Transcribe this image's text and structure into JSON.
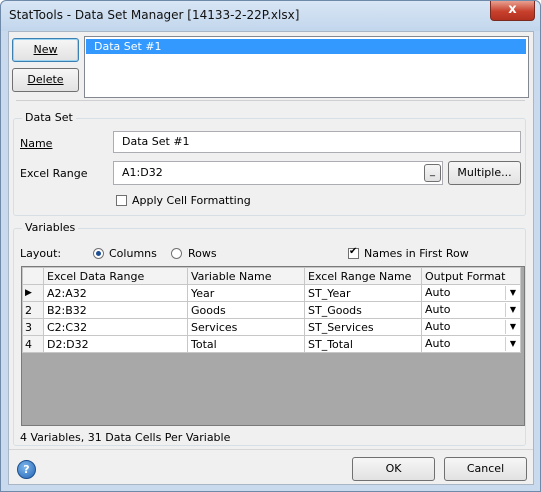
{
  "window": {
    "title": "StatTools - Data Set Manager [14133-2-22P.xlsx]",
    "close_glyph": "x"
  },
  "datasets": {
    "new_label": "New",
    "delete_label": "Delete",
    "items": [
      "Data Set #1"
    ]
  },
  "dataset_group": {
    "title": "Data Set",
    "name_label": "Name",
    "name_value": "Data Set #1",
    "range_label": "Excel Range",
    "range_value": "A1:D32",
    "range_picker_glyph": "_",
    "multiple_label": "Multiple...",
    "apply_format_label": "Apply Cell Formatting",
    "apply_format_checked": false
  },
  "variables_group": {
    "title": "Variables",
    "layout_label": "Layout:",
    "columns_label": "Columns",
    "rows_label": "Rows",
    "layout_selected": "Columns",
    "names_first_row_label": "Names in First Row",
    "names_first_row_checked": true,
    "columns": [
      "Excel Data Range",
      "Variable Name",
      "Excel Range Name",
      "Output Format"
    ],
    "rows": [
      {
        "header": "▶",
        "range": "A2:A32",
        "name": "Year",
        "range_name": "ST_Year",
        "format": "Auto"
      },
      {
        "header": "2",
        "range": "B2:B32",
        "name": "Goods",
        "range_name": "ST_Goods",
        "format": "Auto"
      },
      {
        "header": "3",
        "range": "C2:C32",
        "name": "Services",
        "range_name": "ST_Services",
        "format": "Auto"
      },
      {
        "header": "4",
        "range": "D2:D32",
        "name": "Total",
        "range_name": "ST_Total",
        "format": "Auto"
      }
    ],
    "dropdown_glyph": "▼"
  },
  "status_text": "4 Variables, 31 Data Cells Per Variable",
  "footer": {
    "help_glyph": "?",
    "ok_label": "OK",
    "cancel_label": "Cancel"
  }
}
